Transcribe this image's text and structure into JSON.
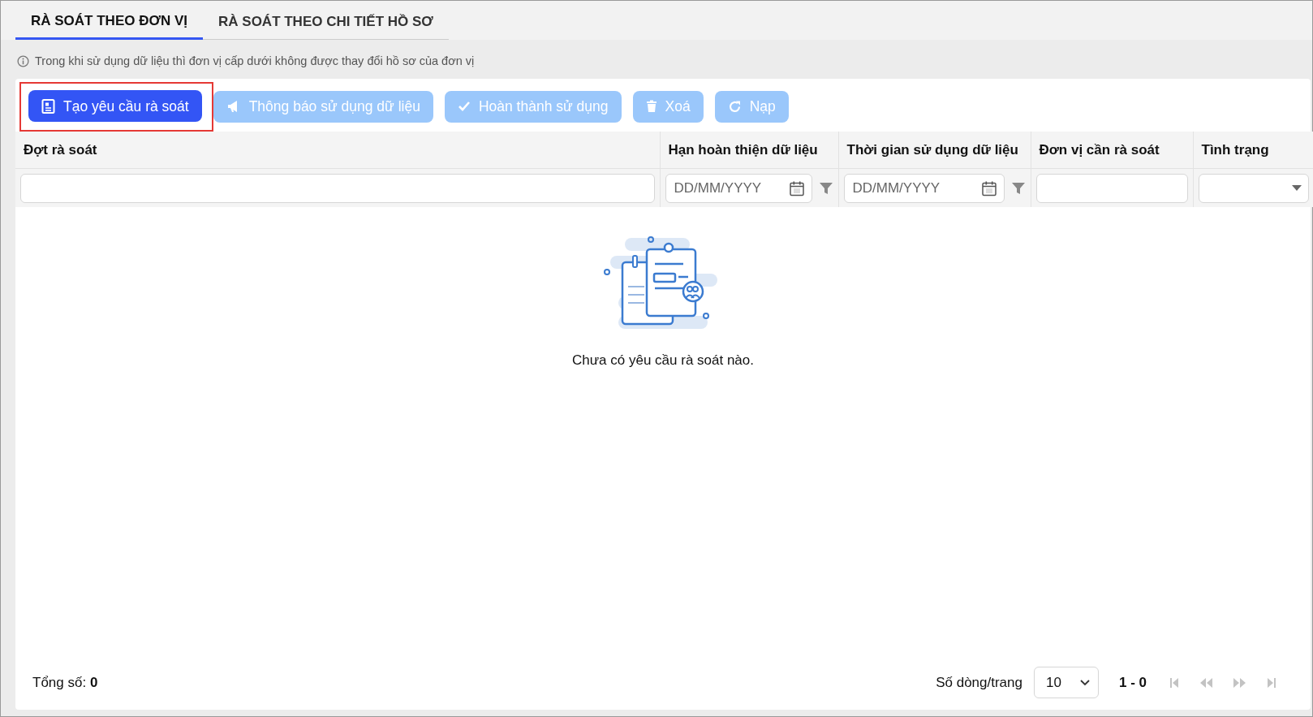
{
  "tabs": [
    {
      "label": "RÀ SOÁT THEO ĐƠN VỊ",
      "selected": true
    },
    {
      "label": "RÀ SOÁT THEO CHI TIẾT HỒ SƠ",
      "selected": false
    }
  ],
  "notice": "Trong khi sử dụng dữ liệu thì đơn vị cấp dưới không được thay đổi hồ sơ của đơn vị",
  "toolbar": [
    {
      "label": "Tạo yêu cầu rà soát",
      "disabled": false,
      "highlighted": true
    },
    {
      "label": "Thông báo sử dụng dữ liệu",
      "disabled": true,
      "highlighted": false
    },
    {
      "label": "Hoàn thành sử dụng",
      "disabled": true,
      "highlighted": false
    },
    {
      "label": "Xoá",
      "disabled": true,
      "highlighted": false
    },
    {
      "label": "Nạp",
      "disabled": true,
      "highlighted": false
    }
  ],
  "table": {
    "columns": [
      {
        "label": "Đợt rà soát",
        "kind": "text"
      },
      {
        "label": "Hạn hoàn thiện dữ liệu",
        "kind": "date",
        "placeholder": "DD/MM/YYYY"
      },
      {
        "label": "Thời gian sử dụng dữ liệu",
        "kind": "date",
        "placeholder": "DD/MM/YYYY"
      },
      {
        "label": "Đơn vị cần rà soát",
        "kind": "text"
      },
      {
        "label": "Tình trạng",
        "kind": "select"
      }
    ],
    "empty_message": "Chưa có yêu cầu rà soát nào."
  },
  "footer": {
    "total_label": "Tổng số:",
    "total": "0",
    "page_size_label": "Số dòng/trang",
    "page_size": "10",
    "range": "1 - 0"
  }
}
